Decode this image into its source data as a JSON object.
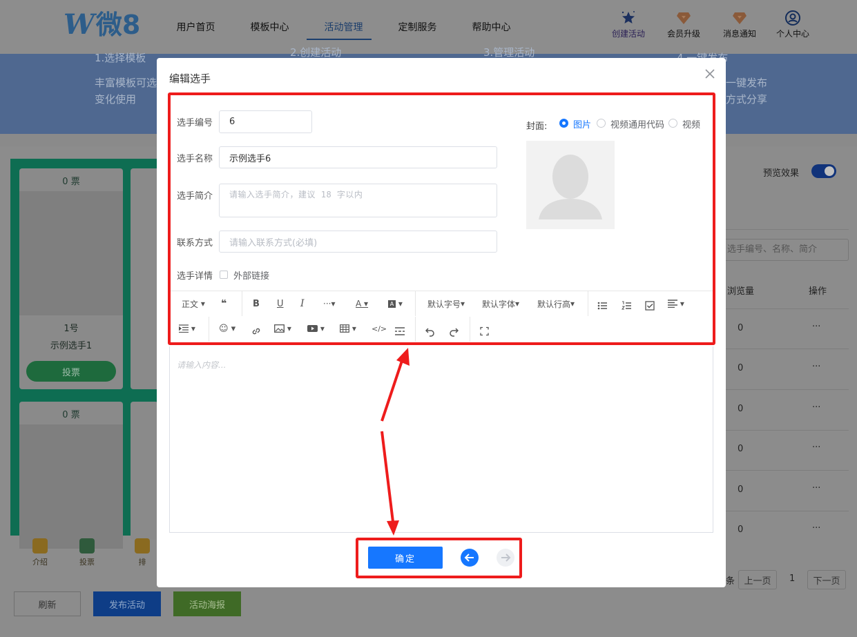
{
  "colors": {
    "accent": "#1677ff",
    "annotation": "#ee1c1c",
    "nav_active": "#1b3f6e"
  },
  "header": {
    "logo_letter": "W",
    "logo_text": "微8",
    "nav": [
      {
        "label": "用户首页"
      },
      {
        "label": "模板中心"
      },
      {
        "label": "活动管理",
        "active": true
      },
      {
        "label": "定制服务"
      },
      {
        "label": "帮助中心"
      }
    ],
    "right": [
      {
        "label": "创建活动",
        "icon": "star-icon"
      },
      {
        "label": "会员升级",
        "icon": "diamond-icon"
      },
      {
        "label": "消息通知",
        "icon": "bell-icon"
      },
      {
        "label": "个人中心",
        "icon": "user-icon"
      }
    ]
  },
  "banner": {
    "steps": [
      {
        "title": "1.选择模板",
        "desc1": "丰富模板可选",
        "desc2": "变化使用"
      },
      {
        "title": "2.创建活动",
        "desc1": "",
        "desc2": ""
      },
      {
        "title": "3.管理活动",
        "desc1": "",
        "desc2": ""
      },
      {
        "title": "4.一键发布",
        "desc1": "一键发布",
        "desc2": "方式分享"
      }
    ]
  },
  "background": {
    "cards": [
      {
        "votes": "0 票",
        "num": "1号",
        "name": "示例选手1",
        "vote_btn": "投票"
      },
      {
        "votes": "0 票"
      },
      {
        "votes": "0 票"
      }
    ],
    "bottom_icons": [
      {
        "label": "介绍",
        "icon": "intro-icon"
      },
      {
        "label": "投票",
        "icon": "vote-icon"
      },
      {
        "label": "排",
        "icon": "trophy-icon"
      }
    ],
    "buttons": {
      "refresh": "刷新",
      "publish": "发布活动",
      "poster": "活动海报"
    },
    "preview_label": "预览效果",
    "search_placeholder": "选手编号、名称、简介",
    "table": {
      "col_views": "浏览量",
      "col_ops": "操作",
      "rows": [
        {
          "views": "0",
          "ops": "···"
        },
        {
          "views": "0",
          "ops": "···"
        },
        {
          "views": "0",
          "ops": "···"
        },
        {
          "views": "0",
          "ops": "···"
        },
        {
          "views": "0",
          "ops": "···"
        },
        {
          "views": "0",
          "ops": "···"
        }
      ]
    },
    "pagination": {
      "prefix": "条",
      "prev": "上一页",
      "page": "1",
      "next": "下一页"
    }
  },
  "modal": {
    "title": "编辑选手",
    "fields": {
      "number": {
        "label": "选手编号",
        "value": "6"
      },
      "name": {
        "label": "选手名称",
        "value": "示例选手6"
      },
      "intro": {
        "label": "选手简介",
        "placeholder": "请输入选手简介，建议 18 字以内"
      },
      "contact": {
        "label": "联系方式",
        "placeholder": "请输入联系方式(必填)"
      },
      "detail": {
        "label": "选手详情",
        "checkbox_label": "外部链接"
      }
    },
    "cover": {
      "label": "封面:",
      "options": [
        {
          "label": "图片",
          "selected": true
        },
        {
          "label": "视频通用代码",
          "selected": false
        },
        {
          "label": "视频",
          "selected": false
        }
      ]
    },
    "toolbar": {
      "paragraph": "正文",
      "font_size": "默认字号",
      "font_family": "默认字体",
      "line_height": "默认行高"
    },
    "editor_placeholder": "请输入内容...",
    "confirm": "确定"
  }
}
